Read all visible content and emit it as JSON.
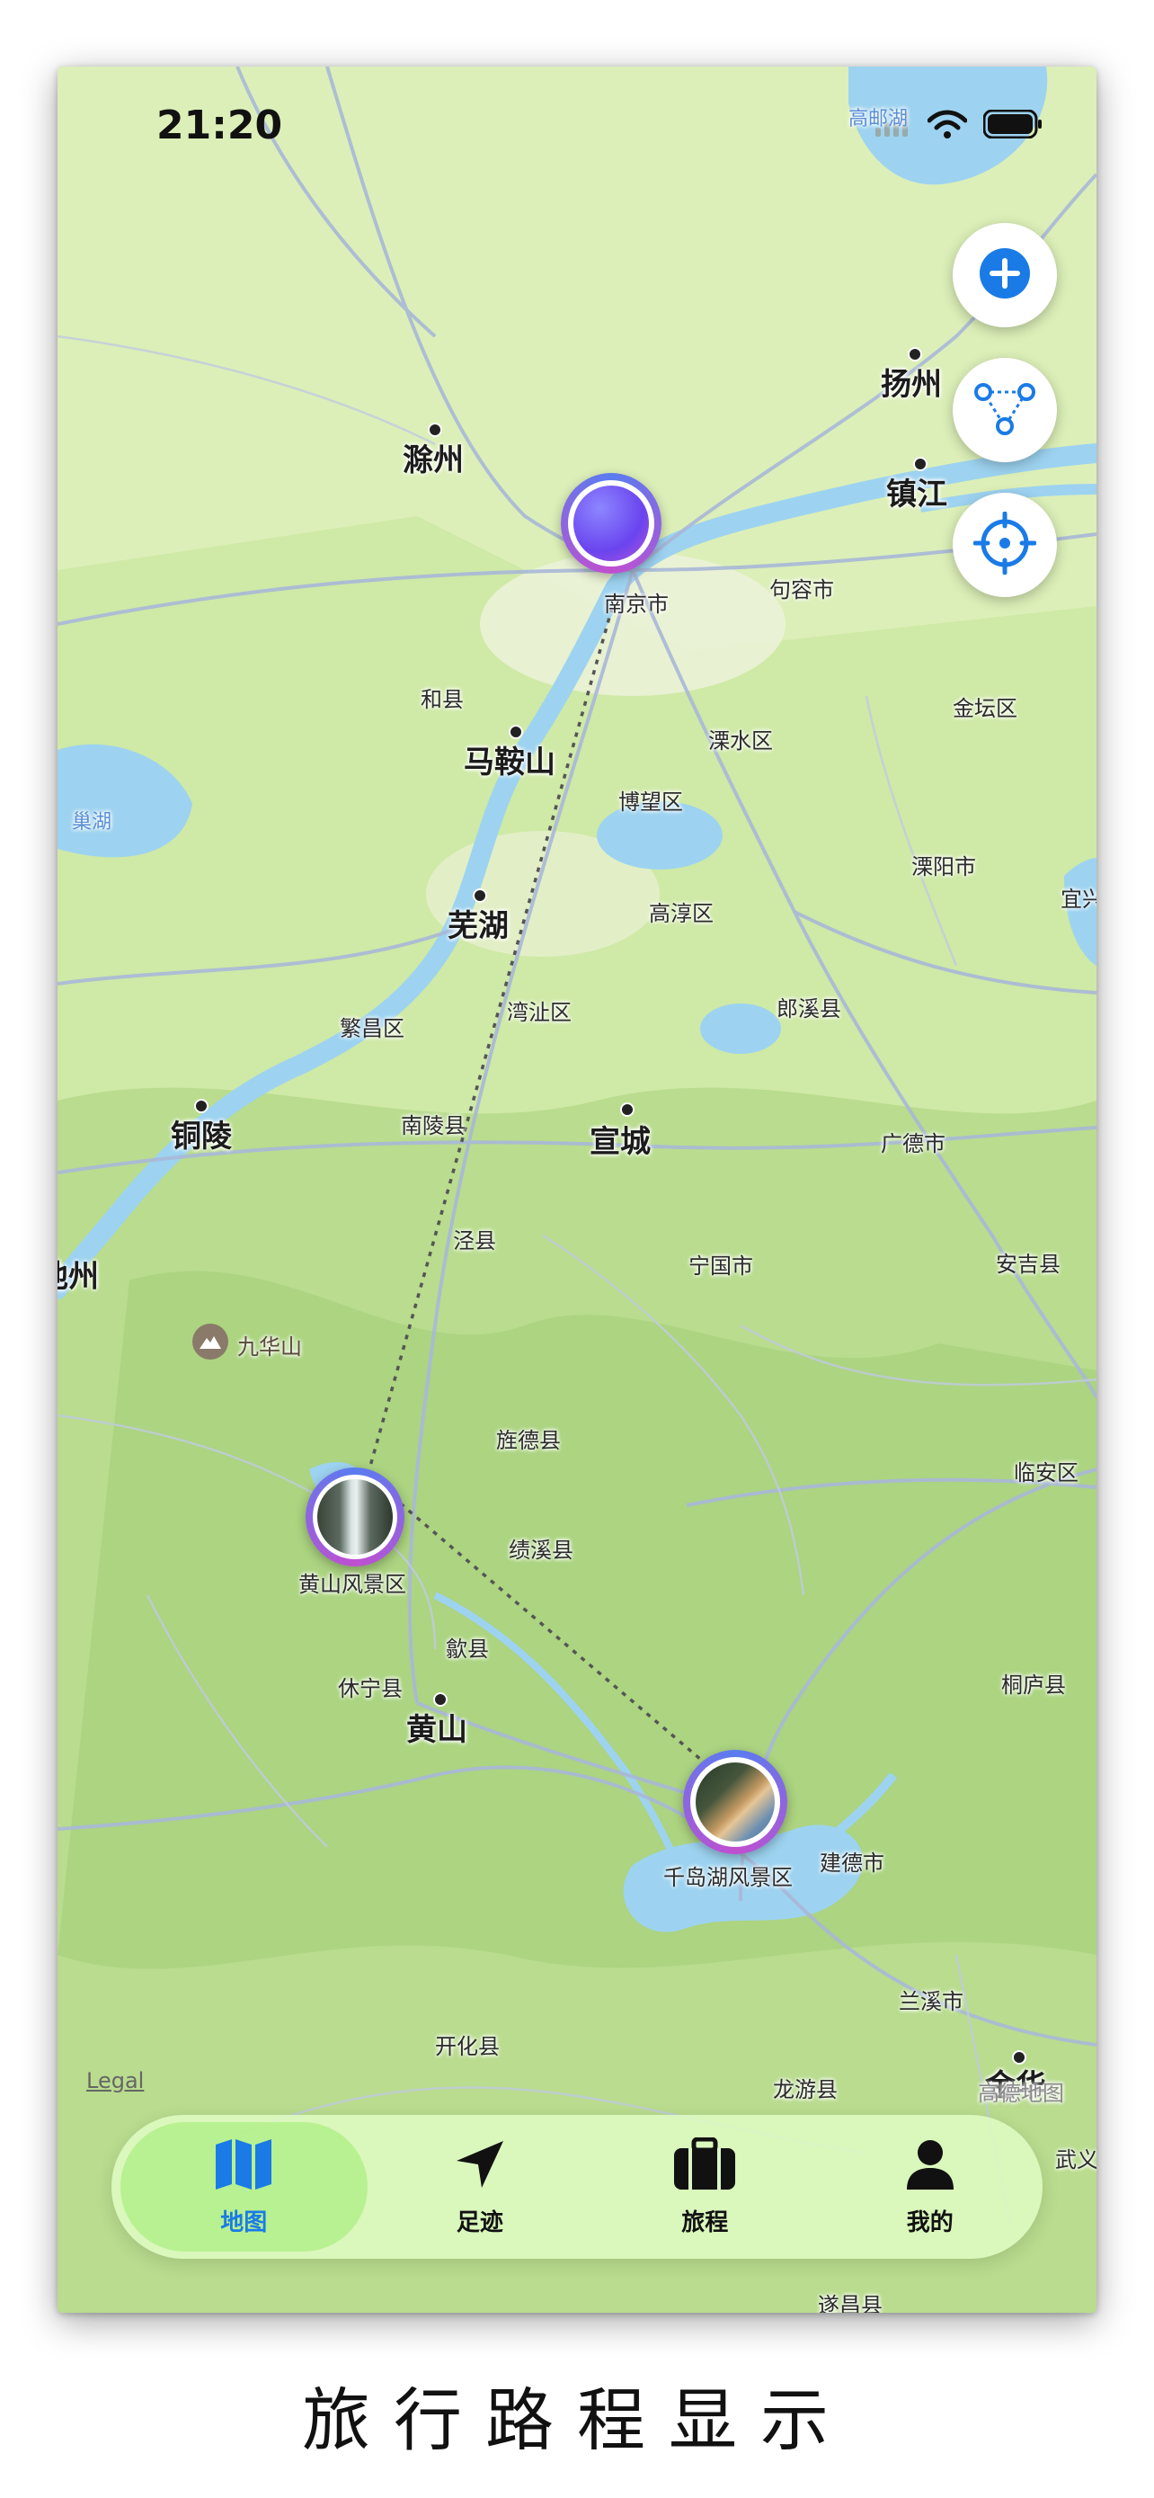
{
  "status": {
    "time": "21:20"
  },
  "map": {
    "labels": [
      {
        "id": "gaoyouhu",
        "text": "高邮湖",
        "kind": "water"
      },
      {
        "id": "yangzhou",
        "text": "扬州",
        "kind": "big"
      },
      {
        "id": "zhenjiang",
        "text": "镇江",
        "kind": "big"
      },
      {
        "id": "chuzhou",
        "text": "滁州",
        "kind": "big"
      },
      {
        "id": "nanjing",
        "text": "南京市",
        "kind": "small"
      },
      {
        "id": "jurong",
        "text": "句容市",
        "kind": "small"
      },
      {
        "id": "hexian",
        "text": "和县",
        "kind": "small"
      },
      {
        "id": "maanshan",
        "text": "马鞍山",
        "kind": "big"
      },
      {
        "id": "lishui",
        "text": "溧水区",
        "kind": "small"
      },
      {
        "id": "jintan",
        "text": "金坛区",
        "kind": "small"
      },
      {
        "id": "chaohu",
        "text": "巢湖",
        "kind": "water"
      },
      {
        "id": "bowang",
        "text": "博望区",
        "kind": "small"
      },
      {
        "id": "liyang",
        "text": "溧阳市",
        "kind": "small"
      },
      {
        "id": "wuhu",
        "text": "芜湖",
        "kind": "big"
      },
      {
        "id": "gaochun",
        "text": "高淳区",
        "kind": "small"
      },
      {
        "id": "yixing",
        "text": "宜兴",
        "kind": "small"
      },
      {
        "id": "fanchang",
        "text": "繁昌区",
        "kind": "small"
      },
      {
        "id": "wanzhi",
        "text": "湾沚区",
        "kind": "small"
      },
      {
        "id": "langxi",
        "text": "郎溪县",
        "kind": "small"
      },
      {
        "id": "tongling",
        "text": "铜陵",
        "kind": "big"
      },
      {
        "id": "nanling",
        "text": "南陵县",
        "kind": "small"
      },
      {
        "id": "xuancheng",
        "text": "宣城",
        "kind": "big"
      },
      {
        "id": "guangde",
        "text": "广德市",
        "kind": "small"
      },
      {
        "id": "chizhou",
        "text": "池州",
        "kind": "big"
      },
      {
        "id": "jingxian",
        "text": "泾县",
        "kind": "small"
      },
      {
        "id": "ningguo",
        "text": "宁国市",
        "kind": "small"
      },
      {
        "id": "anji",
        "text": "安吉县",
        "kind": "small"
      },
      {
        "id": "jiuhuashan",
        "text": "九华山",
        "kind": "poi"
      },
      {
        "id": "jingde",
        "text": "旌德县",
        "kind": "small"
      },
      {
        "id": "linan",
        "text": "临安区",
        "kind": "small"
      },
      {
        "id": "jixi",
        "text": "绩溪县",
        "kind": "small"
      },
      {
        "id": "huangshanfj",
        "text": "黄山风景区",
        "kind": "small"
      },
      {
        "id": "shexian",
        "text": "歙县",
        "kind": "small"
      },
      {
        "id": "xiuning",
        "text": "休宁县",
        "kind": "small"
      },
      {
        "id": "tonglu",
        "text": "桐庐县",
        "kind": "small"
      },
      {
        "id": "huangshan",
        "text": "黄山",
        "kind": "big"
      },
      {
        "id": "qiandaohu",
        "text": "千岛湖风景区",
        "kind": "small"
      },
      {
        "id": "jiande",
        "text": "建德市",
        "kind": "small"
      },
      {
        "id": "lanxi",
        "text": "兰溪市",
        "kind": "small"
      },
      {
        "id": "kaihua",
        "text": "开化县",
        "kind": "small"
      },
      {
        "id": "longyou",
        "text": "龙游县",
        "kind": "small"
      },
      {
        "id": "jinhua",
        "text": "金华",
        "kind": "big"
      },
      {
        "id": "wuyi",
        "text": "武义",
        "kind": "small"
      },
      {
        "id": "suichang",
        "text": "遂昌县",
        "kind": "small"
      }
    ],
    "attribution": "高德地图",
    "legal": "Legal"
  },
  "fab": {
    "add_icon": "plus-icon",
    "route_icon": "route-nodes-icon",
    "locate_icon": "crosshair-icon"
  },
  "tabs": [
    {
      "label": "地图",
      "icon": "map-icon",
      "active": true
    },
    {
      "label": "足迹",
      "icon": "location-arrow-icon",
      "active": false
    },
    {
      "label": "旅程",
      "icon": "suitcase-icon",
      "active": false
    },
    {
      "label": "我的",
      "icon": "person-icon",
      "active": false
    }
  ],
  "caption": "旅行路程显示",
  "colors": {
    "accent": "#1a7be6",
    "land": "#cfe9a6",
    "water": "#9dd3f0",
    "road": "#a9b8d8",
    "pin_ring": "#8a5cf0"
  }
}
